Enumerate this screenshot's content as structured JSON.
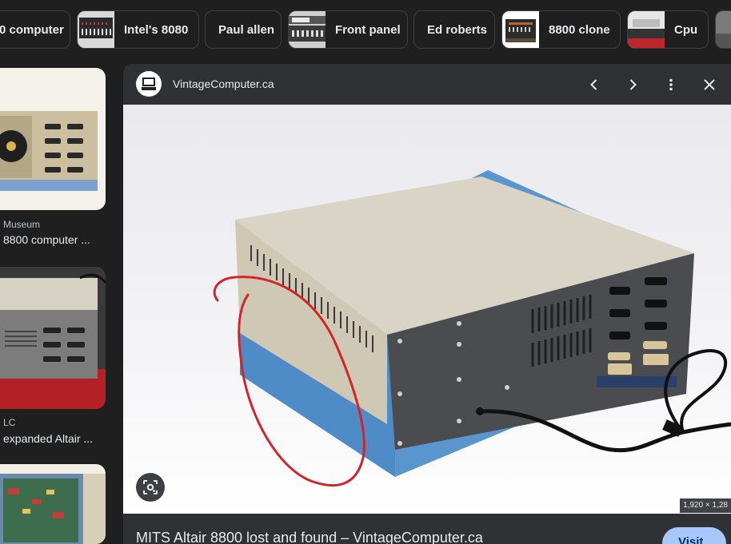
{
  "chips": [
    {
      "label": "0 computer",
      "thumb": false
    },
    {
      "label": "Intel's 8080",
      "thumb": true
    },
    {
      "label": "Paul allen",
      "thumb": false
    },
    {
      "label": "Front panel",
      "thumb": true
    },
    {
      "label": "Ed roberts",
      "thumb": false
    },
    {
      "label": "8800 clone",
      "thumb": true
    },
    {
      "label": "Cpu",
      "thumb": true
    }
  ],
  "results": [
    {
      "source": "Museum",
      "title": "8800 computer ..."
    },
    {
      "source": "LC",
      "title": "expanded Altair ..."
    },
    {
      "source": "",
      "title": ""
    }
  ],
  "preview": {
    "site_name": "VintageComputer.ca",
    "image_dimensions": "1,920 × 1,28",
    "caption": "MITS Altair 8800 lost and found – VintageComputer.ca",
    "visit_label": "Visit"
  },
  "icons": {
    "prev": "chevron-left-icon",
    "next": "chevron-right-icon",
    "more": "more-vert-icon",
    "close": "close-icon",
    "lens": "lens-icon"
  },
  "colors": {
    "background": "#1f1f1f",
    "panel": "#303134",
    "visit_button": "#a8c7fa",
    "annotation": "#d3242c"
  }
}
